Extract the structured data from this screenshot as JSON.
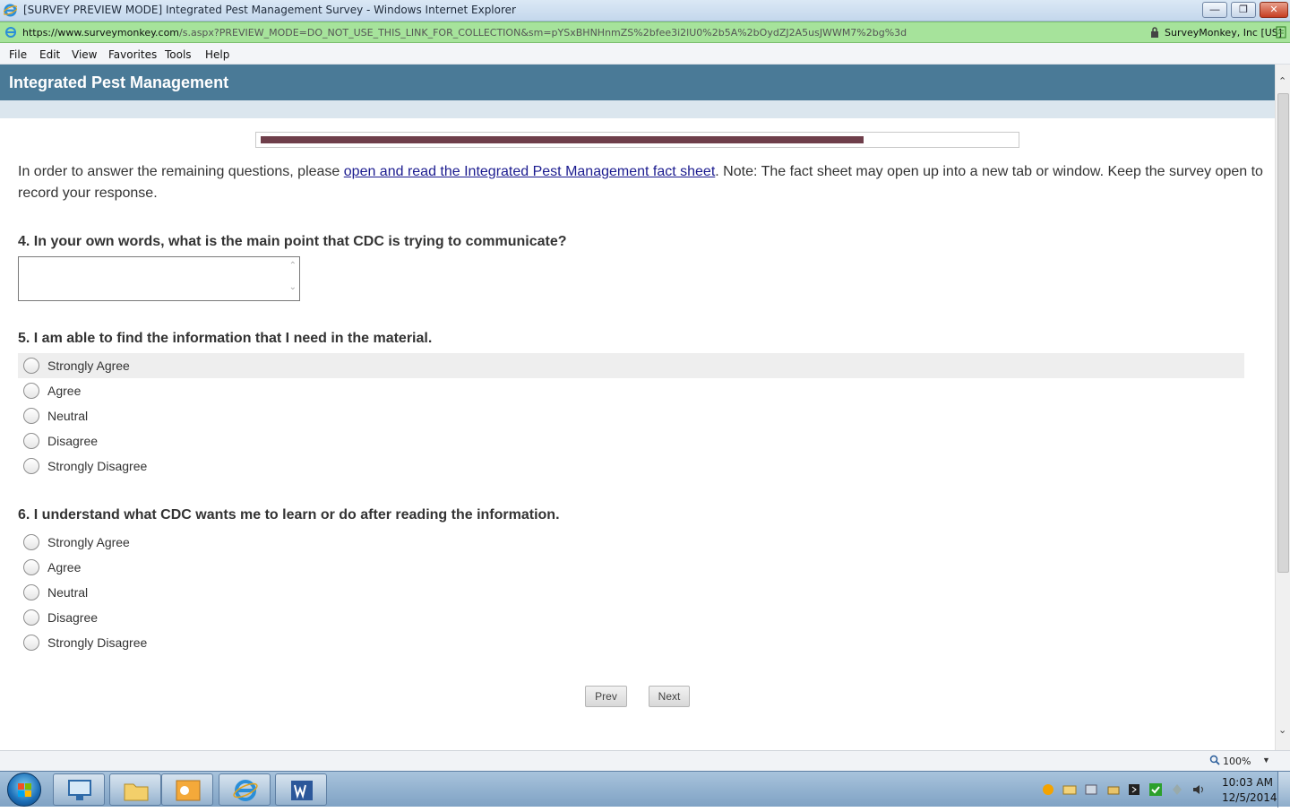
{
  "window": {
    "title": "[SURVEY PREVIEW MODE] Integrated Pest Management Survey - Windows Internet Explorer",
    "min_icon": "minimize-icon",
    "max_icon": "restore-icon",
    "close_icon": "close-icon"
  },
  "address": {
    "url_host": "https://www.surveymonkey.com",
    "url_path": "/s.aspx?PREVIEW_MODE=DO_NOT_USE_THIS_LINK_FOR_COLLECTION&sm=pYSxBHNHnmZS%2bfee3i2lU0%2b5A%2bOydZJ2A5usJWWM7%2bg%3d",
    "certificate": "SurveyMonkey, Inc [US]"
  },
  "menu": [
    "File",
    "Edit",
    "View",
    "Favorites",
    "Tools",
    "Help"
  ],
  "survey": {
    "title": "Integrated Pest Management",
    "progress_fraction": 0.8,
    "intro_before": "In order to answer the remaining questions, please ",
    "intro_link": "open and read the Integrated Pest Management fact sheet",
    "intro_after": ". Note: The fact sheet may open up into a new tab or window. Keep the survey open to record your response.",
    "q4": "4. In your own words, what is the main point that CDC is trying to communicate?",
    "q4_answer": "",
    "q5": "5. I am able to find the information that I need in the material.",
    "q6": "6. I understand what CDC wants me to learn or do after reading the information.",
    "options": [
      "Strongly Agree",
      "Agree",
      "Neutral",
      "Disagree",
      "Strongly Disagree"
    ],
    "prev_label": "Prev",
    "next_label": "Next"
  },
  "status": {
    "zoom": "100%"
  },
  "taskbar": {
    "apps": [
      "remote-desktop",
      "file-explorer",
      "outlook",
      "internet-explorer",
      "word"
    ],
    "time": "10:03 AM",
    "date": "12/5/2014"
  },
  "colors": {
    "header": "#4a7a97",
    "progress": "#6e3e4a",
    "address_bar": "#a6e39b",
    "link": "#1b1b8f"
  }
}
